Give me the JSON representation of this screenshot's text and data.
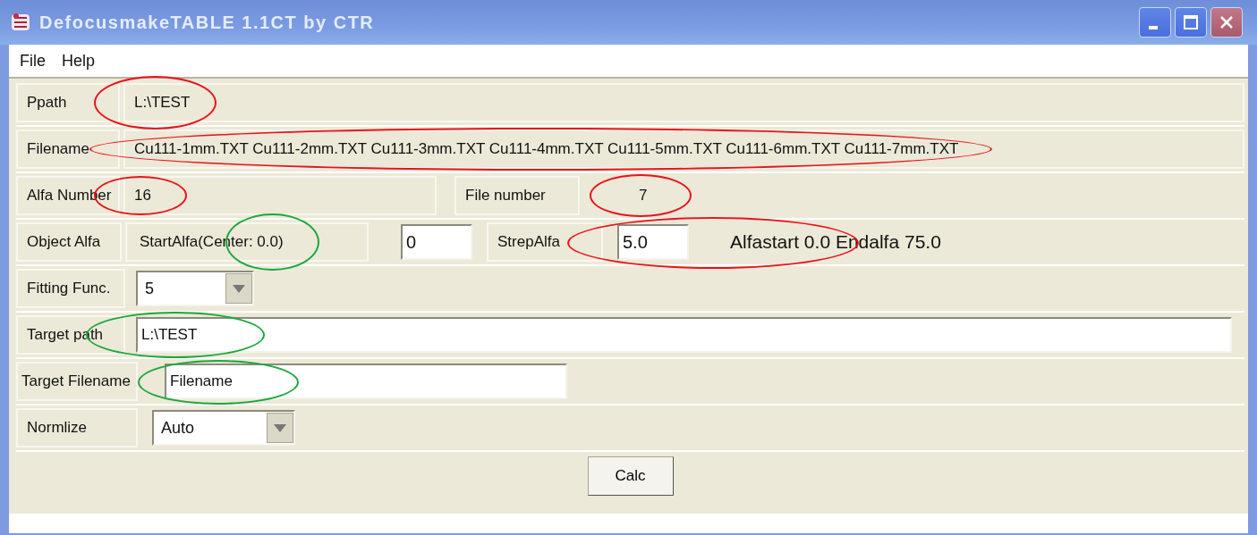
{
  "window": {
    "title": "DefocusmakeTABLE 1.1CT by CTR"
  },
  "menu": [
    "File",
    "Help"
  ],
  "ppath": {
    "label": "Ppath",
    "value": "L:\\TEST",
    "annotation": {
      "color": "#e8141b"
    }
  },
  "filename": {
    "label": "Filename",
    "value": "Cu111-1mm.TXT Cu111-2mm.TXT Cu111-3mm.TXT Cu111-4mm.TXT Cu111-5mm.TXT Cu111-6mm.TXT Cu111-7mm.TXT",
    "annotation": {
      "color": "#e8141b"
    }
  },
  "alfa_number": {
    "label": "Alfa Number",
    "value": "16",
    "annotation": {
      "color": "#e8141b"
    }
  },
  "file_number": {
    "label": "File number",
    "value": "7",
    "annotation": {
      "color": "#e8141b"
    }
  },
  "object_alfa": {
    "label": "Object Alfa",
    "start_label": "StartAlfa(Center: 0.0)",
    "start_annotation": {
      "color": "#1aa83c"
    },
    "start_value": "0",
    "step_label": "StrepAlfa",
    "step_value": "5.0",
    "step_annotation": {
      "color": "#e8141b"
    },
    "summary": "Alfastart 0.0 Endalfa 75.0"
  },
  "fitting": {
    "label": "Fitting Func.",
    "value": "5"
  },
  "target_path": {
    "label": "Target path",
    "value": "L:\\TEST",
    "annotation": {
      "color": "#1aa83c"
    }
  },
  "target_filename": {
    "label": "Target Filename",
    "value": "Filename",
    "annotation": {
      "color": "#1aa83c"
    }
  },
  "normalize": {
    "label": "Normlize",
    "value": "Auto"
  },
  "calc_button": "Calc"
}
